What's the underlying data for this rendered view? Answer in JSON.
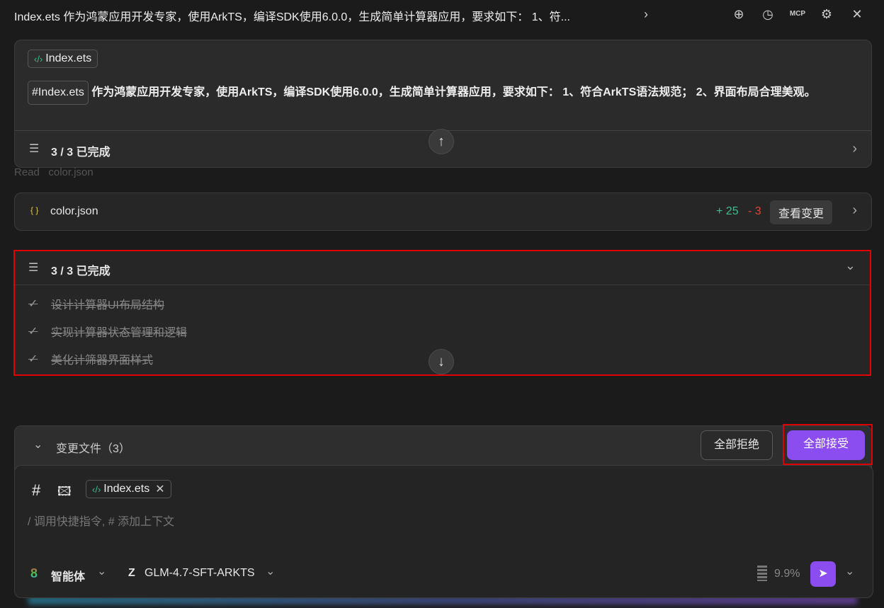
{
  "header": {
    "title": "Index.ets 作为鸿蒙应用开发专家，使用ArkTS，编译SDK使用6.0.0，生成简单计算器应用，要求如下： 1、符...",
    "icons": [
      "new-chat-icon",
      "history-icon",
      "mcp-icon",
      "gear-icon",
      "close-icon"
    ],
    "mcp": "MCP"
  },
  "prompt": {
    "file_chip": "Index.ets",
    "ref_chip": "#Index.ets",
    "text": "作为鸿蒙应用开发专家，使用ArkTS，编译SDK使用6.0.0，生成简单计算器应用，要求如下： 1、符合ArkTS语法规范； 2、界面布局合理美观。",
    "progress": "3 / 3 已完成"
  },
  "read": {
    "label": "Read",
    "file": "color.json"
  },
  "file_change": {
    "name": "color.json",
    "added": "+ 25",
    "removed": "- 3",
    "view_label": "查看变更"
  },
  "todos": {
    "title": "3 / 3 已完成",
    "items": [
      "设计计算器UI布局结构",
      "实现计算器状态管理和逻辑",
      "美化计筛器界面样式"
    ]
  },
  "changes": {
    "title": "变更文件（3）",
    "reject_label": "全部拒绝",
    "accept_label": "全部接受"
  },
  "input": {
    "chip": "Index.ets",
    "placeholder": "/ 调用快捷指令, # 添加上下文",
    "agent": "智能体",
    "model": "GLM-4.7-SFT-ARKTS",
    "usage": "9.9%"
  },
  "colors": {
    "accent": "#8b4cf0",
    "highlight": "#e00000",
    "green": "#3fbf8f",
    "red": "#e0443a"
  }
}
